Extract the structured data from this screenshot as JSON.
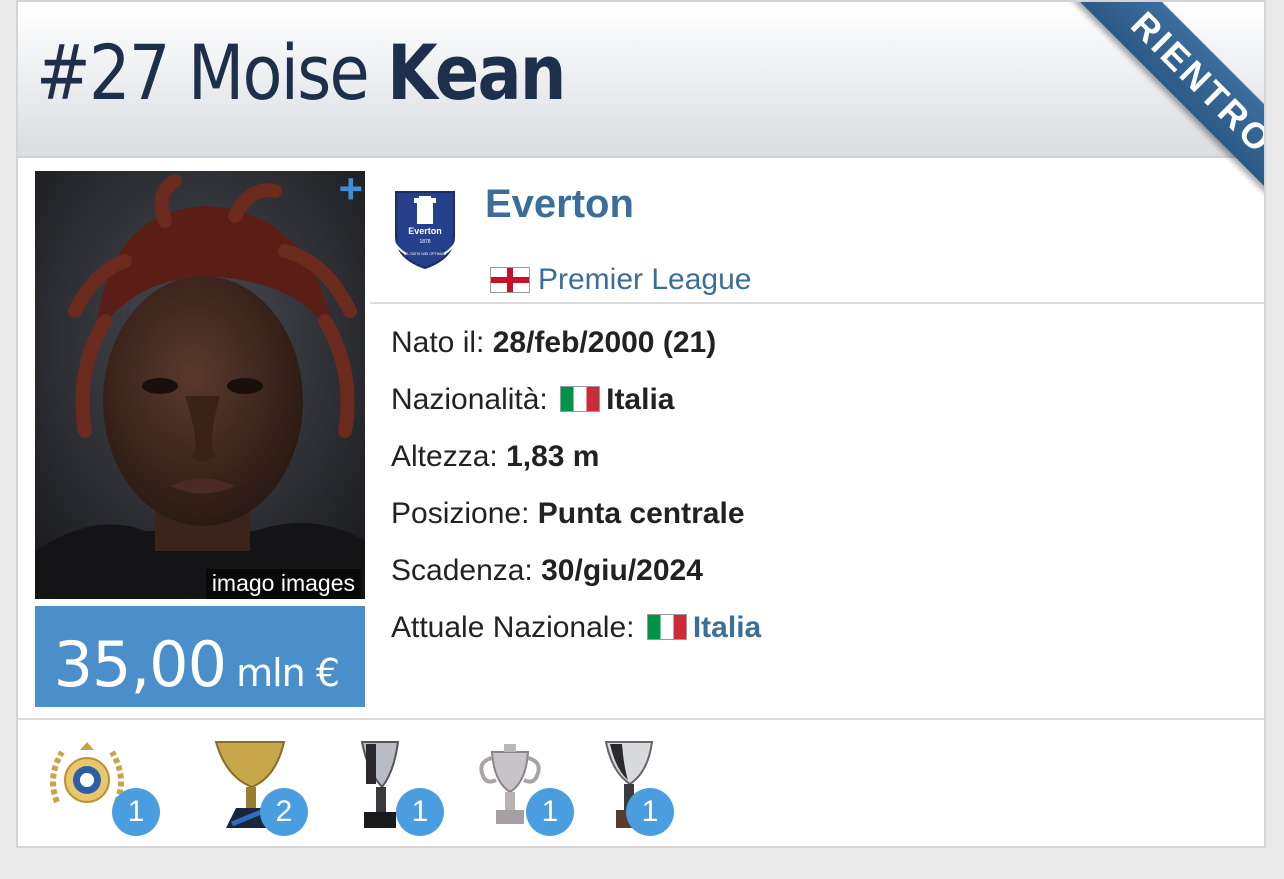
{
  "player": {
    "number_name": "#27 Moise",
    "last_name": "Kean",
    "ribbon": "RIENTRO",
    "photo_credit": "imago images",
    "plus": "+",
    "market_value": "35,00",
    "market_value_unit": "mln €"
  },
  "club": {
    "name": "Everton",
    "league": "Premier League",
    "logo_text": "Everton",
    "logo_year": "1878",
    "logo_motto": "NIL SATIS NISI OPTIMUM"
  },
  "info": [
    {
      "label": "Nato il:",
      "value": "28/feb/2000 (21)"
    },
    {
      "label": "Nazionalità:",
      "value": "Italia"
    },
    {
      "label": "Altezza:",
      "value": "1,83 m"
    },
    {
      "label": "Posizione:",
      "value": "Punta centrale"
    },
    {
      "label": "Scadenza:",
      "value": "30/giu/2024"
    },
    {
      "label": "Attuale Nazionale:",
      "value": "Italia"
    }
  ],
  "trophies": [
    {
      "icon": "laurel-ball-badge-icon",
      "count": "1"
    },
    {
      "icon": "gold-cup-icon",
      "count": "2"
    },
    {
      "icon": "silver-black-cup-icon",
      "count": "1"
    },
    {
      "icon": "silver-two-handle-cup-icon",
      "count": "1"
    },
    {
      "icon": "silver-tall-cup-icon",
      "count": "1"
    }
  ],
  "colors": {
    "accent": "#3b6e9b",
    "ribbon": "#2c5a86",
    "value_box": "#4a8fca",
    "badge": "#4a9ee0",
    "title": "#1d2f4a"
  }
}
